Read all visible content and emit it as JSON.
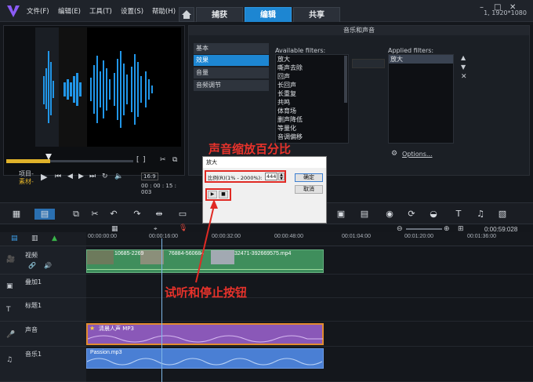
{
  "menu": [
    "文件(F)",
    "编辑(E)",
    "工具(T)",
    "设置(S)",
    "帮助(H)"
  ],
  "tabs": [
    "捕获",
    "编辑",
    "共享"
  ],
  "resolution": "1, 1920*1080",
  "panel_title": "音乐和声音",
  "nav": [
    "基本",
    "效果",
    "音量",
    "音频调节"
  ],
  "available_label": "Available filters:",
  "available": [
    "放大",
    "嘶声去除",
    "回声",
    "长回声",
    "长重复",
    "共鸣",
    "体育场",
    "删声降低",
    "等量化",
    "音调偏移"
  ],
  "applied_label": "Applied filters:",
  "applied": [
    "放大"
  ],
  "options_label": "Options...",
  "transport": {
    "project": "项目-",
    "clip": "素材-",
    "timecode": "00 : 00 : 15 : 003",
    "ratio": "16:9"
  },
  "timecode_right": "0:00:59:028",
  "ruler": [
    "00:00:00:00",
    "00:00:16:00",
    "00:00:32:00",
    "00:00:48:00",
    "00:01:04:00",
    "00:01:20:00",
    "00:01:36:00"
  ],
  "tracks": [
    "视频",
    "叠加1",
    "标题1",
    "声音",
    "音乐1"
  ],
  "clips": {
    "v1": "10685-2269",
    "v2": "76884-560684",
    "v3": "32471-392669575.mp4",
    "voice": "清晨人声 MP3",
    "music": "Passion.mp3"
  },
  "dialog": {
    "title": "放大",
    "ratio_label": "比例(R)(1% - 2000%):",
    "ratio_value": "444",
    "ok": "确定",
    "cancel": "取消",
    "play": "▶",
    "stop": "■"
  },
  "annotations": {
    "top": "声音缩放百分比",
    "bottom": "试听和停止按钮"
  }
}
